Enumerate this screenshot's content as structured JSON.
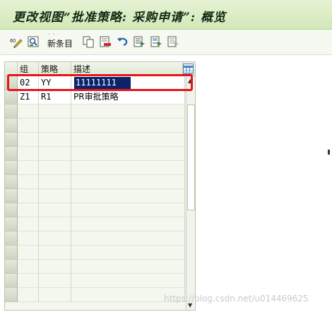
{
  "window": {
    "title": "更改视图“批准策略: 采购申请”: 概览"
  },
  "toolbar": {
    "new_entries_label": "新条目",
    "dots": "· ·",
    "icons": [
      "change-display-icon",
      "detail-icon",
      "copy-icon",
      "delete-icon",
      "undo-icon",
      "select-all-icon",
      "select-block-icon",
      "deselect-icon"
    ]
  },
  "table": {
    "columns": [
      "组",
      "策略",
      "描述"
    ],
    "rows": [
      {
        "group": "02",
        "strategy": "YY",
        "description": "11111111",
        "highlighted": true
      },
      {
        "group": "Z1",
        "strategy": "R1",
        "description": "PR审批策略",
        "highlighted": false
      }
    ]
  },
  "watermark": "https://blog.csdn.net/u014469625",
  "colors": {
    "title_bg": "#d3e8b8",
    "highlight_box": "#e8141a",
    "selection": "#0a246a"
  }
}
